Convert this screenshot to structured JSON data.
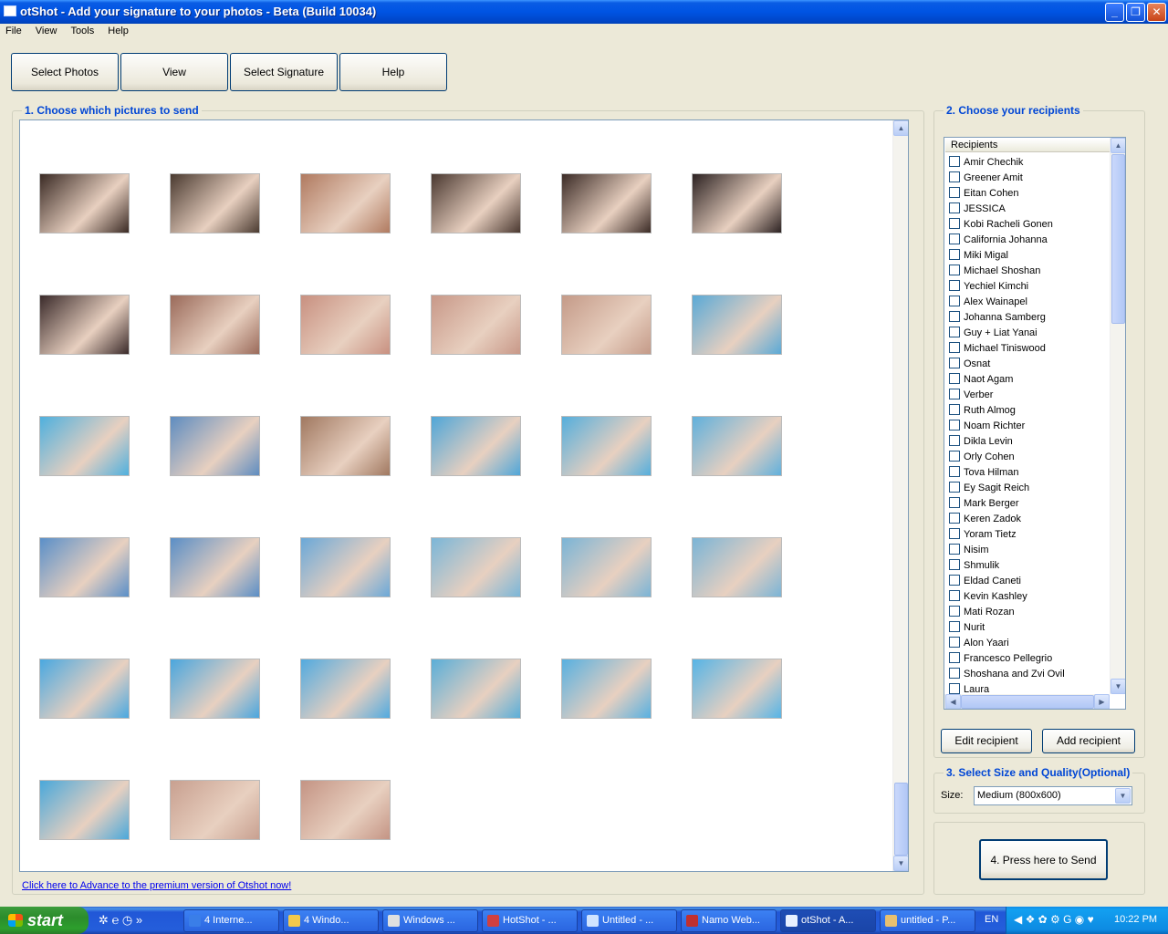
{
  "window": {
    "title": "otShot - Add your signature to your photos - Beta (Build 10034)"
  },
  "menu": [
    "File",
    "View",
    "Tools",
    "Help"
  ],
  "toolbar": {
    "select_photos": "Select Photos",
    "view": "View",
    "select_signature": "Select Signature",
    "help": "Help"
  },
  "section1": {
    "title": "1. Choose which pictures to send"
  },
  "photos_count": 33,
  "photo_colors": [
    [
      "#3a2a24",
      "#4a3a30",
      "#b07a60",
      "#4a3830",
      "#3b2b26",
      "#2c2222"
    ],
    [
      "#3a2a2a",
      "#9a6a5a",
      "#c89080",
      "#c89888",
      "#c49a88",
      "#5aa9d6"
    ],
    [
      "#4fb0de",
      "#5e8cc0",
      "#a07860",
      "#4fa6d8",
      "#55aedc",
      "#60b0dc"
    ],
    [
      "#5a8fc8",
      "#5a8ec6",
      "#6aa8d8",
      "#7ab6d8",
      "#7ab4d6",
      "#7ab4d6"
    ],
    [
      "#4aa8e0",
      "#4aa6de",
      "#52aadf",
      "#5aaed8",
      "#58b0e0",
      "#56b4e6"
    ],
    [
      "#4aa8da",
      "#c8a090",
      "#c49484"
    ]
  ],
  "premium_link": "Click here to Advance to the premium version of Otshot now!",
  "section2": {
    "title": "2. Choose your recipients",
    "header": "Recipients"
  },
  "recipients": [
    "Amir Chechik",
    "Greener Amit",
    "Eitan Cohen",
    "JESSICA",
    "Kobi Racheli Gonen",
    "California Johanna",
    "Miki Migal",
    "Michael Shoshan",
    "Yechiel Kimchi",
    "Alex Wainapel",
    "Johanna Samberg",
    "Guy + Liat Yanai",
    "Michael Tiniswood",
    "Osnat",
    "Naot Agam",
    "Verber",
    "Ruth Almog",
    "Noam Richter",
    "Dikla Levin",
    "Orly Cohen",
    "Tova Hilman",
    "Ey Sagit Reich",
    "Mark Berger",
    "Keren Zadok",
    "Yoram Tietz",
    "Nisim",
    "Shmulik",
    "Eldad Caneti",
    "Kevin Kashley",
    "Mati Rozan",
    "Nurit",
    "Alon Yaari",
    "Francesco Pellegrio",
    "Shoshana and Zvi Ovil",
    "Laura"
  ],
  "buttons": {
    "edit_recipient": "Edit recipient",
    "add_recipient": "Add recipient",
    "send": "4. Press here to Send"
  },
  "section3": {
    "title": "3. Select Size and Quality(Optional)",
    "size_label": "Size:",
    "size_value": "Medium (800x600)"
  },
  "taskbar": {
    "start": "start",
    "tasks": [
      "4 Interne...",
      "4 Windo...",
      "Windows ...",
      "HotShot - ...",
      "Untitled - ...",
      "Namo Web...",
      "otShot - A...",
      "untitled - P..."
    ],
    "lang": "EN",
    "clock": "10:22 PM"
  }
}
